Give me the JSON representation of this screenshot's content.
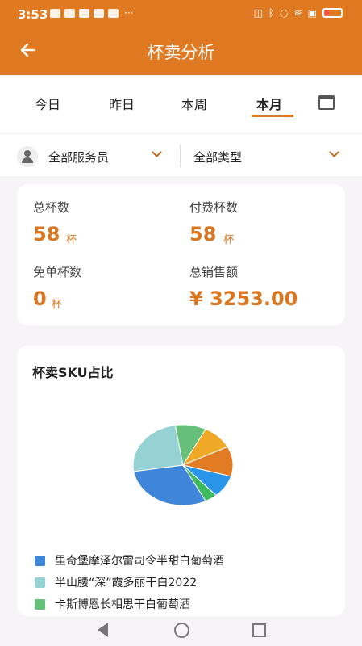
{
  "status": {
    "time": "3:53"
  },
  "header": {
    "title": "杯卖分析"
  },
  "tabs": [
    "今日",
    "昨日",
    "本周",
    "本月"
  ],
  "filters": {
    "staff": "全部服务员",
    "type": "全部类型"
  },
  "stats": [
    {
      "label": "总杯数",
      "value": "58",
      "unit": "杯"
    },
    {
      "label": "付费杯数",
      "value": "58",
      "unit": "杯"
    },
    {
      "label": "免单杯数",
      "value": "0",
      "unit": "杯"
    },
    {
      "label": "总销售额",
      "value": "¥ 3253.00",
      "unit": ""
    }
  ],
  "chart_data": {
    "type": "pie",
    "title": "杯卖SKU占比",
    "labels": [
      "里奇堡摩泽尔雷司令半甜白葡萄酒",
      "半山腰“深”霞多丽干白2022",
      "卡斯博恩长相思干白葡萄酒"
    ],
    "slice_fractions": [
      0.3,
      0.25,
      0.1,
      0.1,
      0.12,
      0.09,
      0.04
    ],
    "colors": [
      "#3f86d9",
      "#96d2d3",
      "#66c07a",
      "#f0a827",
      "#e17c24",
      "#2a94e8",
      "#3dba5d"
    ]
  },
  "nav": {
    "back_label": "back",
    "home_label": "home",
    "recent_label": "recent"
  }
}
